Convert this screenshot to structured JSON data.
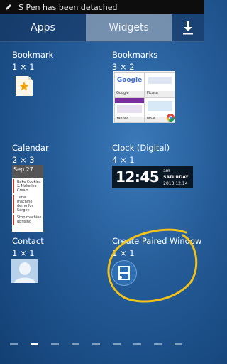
{
  "status_bar": {
    "notification": "S Pen has been detached",
    "pen_icon": "pen-icon"
  },
  "tabs": [
    {
      "label": "Apps",
      "active": false
    },
    {
      "label": "Widgets",
      "active": true
    }
  ],
  "download_icon": "download-icon",
  "widgets": [
    {
      "name": "Bookmark",
      "size": "1 × 1"
    },
    {
      "name": "Bookmarks",
      "size": "3 × 2"
    },
    {
      "name": "Calendar",
      "size": "2 × 3"
    },
    {
      "name": "Clock (Digital)",
      "size": "4 × 1"
    },
    {
      "name": "Contact",
      "size": "1 × 1"
    },
    {
      "name": "Create Paired Window",
      "size": "1 × 1"
    }
  ],
  "calendar_preview": {
    "day": "Sep 27",
    "events": [
      "Bake Cookies & Make Ice Cream",
      "Time machine demo for Sergey",
      "Stop machine uprising"
    ]
  },
  "clock_preview": {
    "time": "12:45",
    "meridiem": "am",
    "weekday": "SATURDAY",
    "date": "2013.12.14"
  },
  "bookmarks_preview": {
    "labels": [
      "Google",
      "Picasa",
      "Yahoo!",
      "MSN"
    ]
  },
  "page_indicator": {
    "count": 9,
    "active_index": 1
  },
  "annotation": {
    "color": "#f2c21b"
  }
}
